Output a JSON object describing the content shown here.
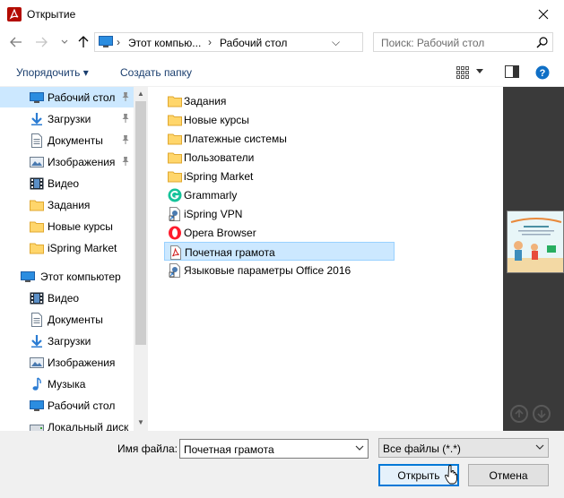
{
  "window": {
    "title": "Открытие"
  },
  "address": {
    "crumbs": [
      "Этот компью...",
      "Рабочий стол"
    ],
    "search_placeholder": "Поиск: Рабочий стол"
  },
  "toolbar": {
    "organize_label": "Упорядочить ▾",
    "new_folder_label": "Создать папку"
  },
  "nav": {
    "quick_access": [
      {
        "label": "Рабочий стол",
        "icon": "desktop-icon",
        "pinned": true,
        "selected": true
      },
      {
        "label": "Загрузки",
        "icon": "download-icon",
        "pinned": true
      },
      {
        "label": "Документы",
        "icon": "documents-icon",
        "pinned": true
      },
      {
        "label": "Изображения",
        "icon": "pictures-icon",
        "pinned": true
      },
      {
        "label": "Видео",
        "icon": "video-icon"
      },
      {
        "label": "Задания",
        "icon": "folder-icon"
      },
      {
        "label": "Новые курсы",
        "icon": "folder-icon"
      },
      {
        "label": "iSpring Market",
        "icon": "folder-icon"
      }
    ],
    "this_pc": {
      "label": "Этот компьютер",
      "icon": "computer-icon"
    },
    "this_pc_items": [
      {
        "label": "Видео",
        "icon": "video-icon"
      },
      {
        "label": "Документы",
        "icon": "documents-icon"
      },
      {
        "label": "Загрузки",
        "icon": "download-icon"
      },
      {
        "label": "Изображения",
        "icon": "pictures-icon"
      },
      {
        "label": "Музыка",
        "icon": "music-icon"
      },
      {
        "label": "Рабочий стол",
        "icon": "desktop-icon"
      },
      {
        "label": "Локальный диск",
        "icon": "disk-icon"
      }
    ]
  },
  "files": [
    {
      "label": "Задания",
      "icon": "folder-icon"
    },
    {
      "label": "Новые курсы",
      "icon": "folder-icon"
    },
    {
      "label": "Платежные системы",
      "icon": "folder-icon"
    },
    {
      "label": "Пользователи",
      "icon": "folder-icon"
    },
    {
      "label": "iSpring Market",
      "icon": "folder-icon"
    },
    {
      "label": "Grammarly",
      "icon": "grammarly-icon"
    },
    {
      "label": "iSpring VPN",
      "icon": "shortcut-icon"
    },
    {
      "label": "Opera Browser",
      "icon": "opera-icon"
    },
    {
      "label": "Почетная грамота",
      "icon": "pdf-icon",
      "selected": true
    },
    {
      "label": "Языковые параметры Office 2016",
      "icon": "shortcut-icon"
    }
  ],
  "bottom": {
    "filename_label": "Имя файла:",
    "filename_value": "Почетная грамота",
    "filter_value": "Все файлы (*.*)",
    "open_label": "Открыть",
    "cancel_label": "Отмена"
  },
  "colors": {
    "accent": "#0078d7",
    "selection": "#cce8ff",
    "folder": "#ffd66b",
    "preview_bg": "#3a3a3a"
  }
}
